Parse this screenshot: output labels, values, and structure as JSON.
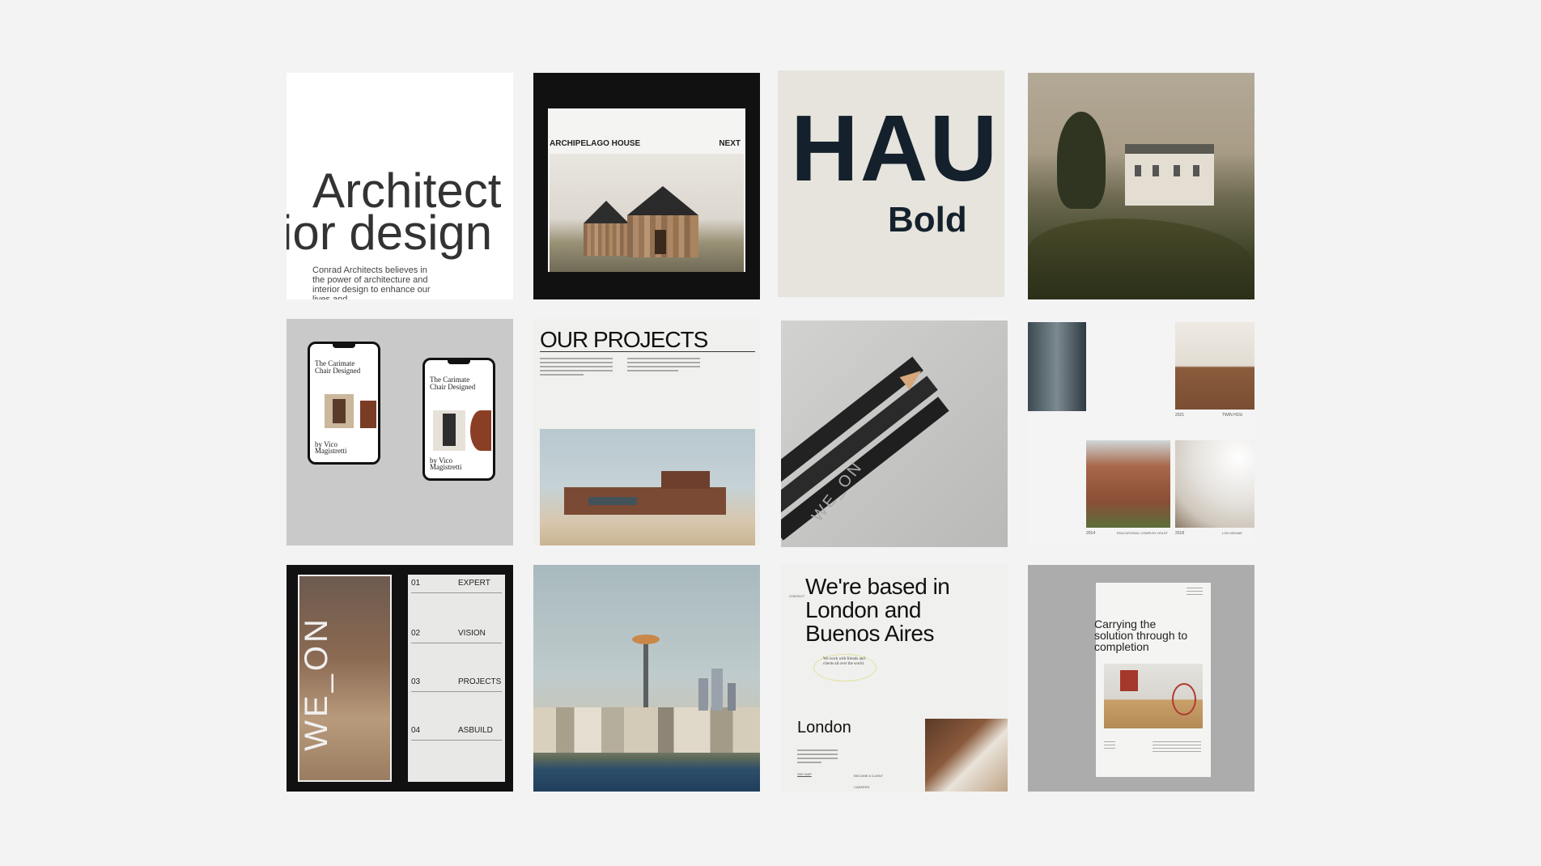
{
  "tile1": {
    "line1": "Architect",
    "line2": "ior design",
    "body": "Conrad Architects believes in the power of architecture and interior design to enhance our lives and"
  },
  "tile2": {
    "title": "ARCHIPELAGO HOUSE",
    "next": "NEXT"
  },
  "tile3": {
    "big": "HAU",
    "weight": "Bold"
  },
  "tile5": {
    "heading": "The Carimate Chair Designed",
    "byline": "by Vico Magistretti"
  },
  "tile6": {
    "heading": "OUR PROJECTS"
  },
  "tile7": {
    "pencil_text": "WE_ON"
  },
  "tile8": {
    "year1": "2021",
    "name1": "TWIN HOU",
    "year2": "2014",
    "name2": "EDUCATIONAL COMPLEX HOLST",
    "year3": "2018",
    "name3": "LOD MICHAE"
  },
  "tile9": {
    "vertical": "WE_ON",
    "items": [
      {
        "num": "01",
        "label": "EXPERT"
      },
      {
        "num": "02",
        "label": "VISION"
      },
      {
        "num": "03",
        "label": "PROJECTS"
      },
      {
        "num": "04",
        "label": "ASBUILD"
      }
    ]
  },
  "tile11": {
    "contact": "CONTACT",
    "heading": "We're based in London and Buenos Aires",
    "note": "We work with friends and clients all over the world.",
    "city": "London",
    "become": "BECOME A CLIENT",
    "careers": "CAREERS",
    "see_map": "SEE MAP"
  },
  "tile12": {
    "heading": "Carrying the solution through to completion"
  }
}
